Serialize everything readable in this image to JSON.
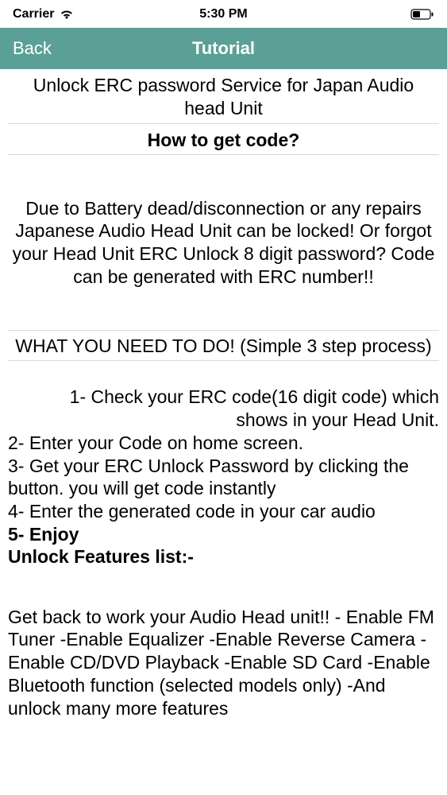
{
  "status": {
    "carrier": "Carrier",
    "time": "5:30 PM"
  },
  "nav": {
    "back": "Back",
    "title": "Tutorial"
  },
  "content": {
    "main_title": "Unlock ERC password Service for Japan Audio head Unit",
    "subtitle": "How to get code?",
    "intro": "Due to Battery dead/disconnection or any repairs Japanese Audio Head Unit can be locked! Or forgot your Head Unit ERC Unlock 8 digit password?  Code can be generated with ERC number!!",
    "section_title": "WHAT YOU NEED TO DO! (Simple 3 step process)",
    "step1": "1-   Check your ERC code(16 digit code) which shows in your Head Unit.",
    "step2": "2-   Enter your Code on home screen.",
    "step3": "3-   Get your ERC Unlock Password by clicking the button. you will get code instantly",
    "step4": "4-   Enter the generated code in your car audio",
    "step5": "5-   Enjoy",
    "features_title": "Unlock Features list:-",
    "features_body": "Get back to work your Audio Head unit!!  - Enable FM Tuner    -Enable Equalizer   -Enable Reverse Camera    -Enable CD/DVD Playback   -Enable SD Card   -Enable Bluetooth function (selected models only)   -And unlock many more features"
  }
}
